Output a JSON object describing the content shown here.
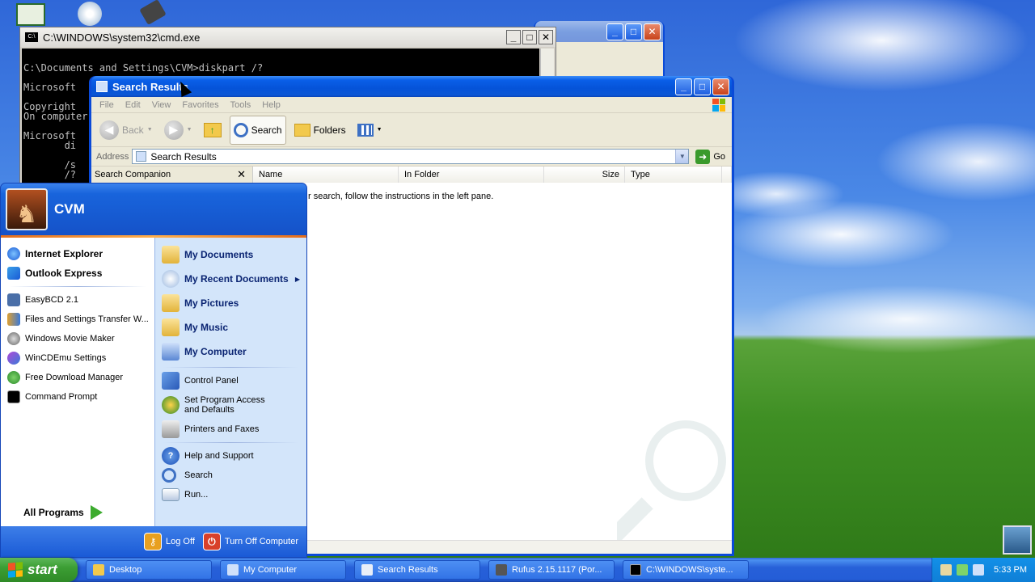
{
  "cmd": {
    "title": "C:\\WINDOWS\\system32\\cmd.exe",
    "lines": [
      "",
      "C:\\Documents and Settings\\CVM>diskpart /?",
      "",
      "Microsoft",
      "",
      "Copyright",
      "On computer",
      "",
      "Microsoft",
      "       di",
      "",
      "       /s",
      "       /?"
    ]
  },
  "search_window": {
    "title": "Search Results",
    "menu": [
      "File",
      "Edit",
      "View",
      "Favorites",
      "Tools",
      "Help"
    ],
    "toolbar": {
      "back": "Back",
      "search": "Search",
      "folders": "Folders"
    },
    "address_label": "Address",
    "address_value": "Search Results",
    "go_label": "Go",
    "companion_title": "Search Companion",
    "columns": [
      "Name",
      "In Folder",
      "Size",
      "Type"
    ],
    "hint": "r search, follow the instructions in the left pane."
  },
  "start_menu": {
    "user": "CVM",
    "pinned": [
      "Internet Explorer",
      "Outlook Express"
    ],
    "recent": [
      "EasyBCD 2.1",
      "Files and Settings Transfer W...",
      "Windows Movie Maker",
      "WinCDEmu Settings",
      "Free Download Manager",
      "Command Prompt"
    ],
    "all_programs": "All Programs",
    "places": [
      "My Documents",
      "My Recent Documents",
      "My Pictures",
      "My Music",
      "My Computer"
    ],
    "settings": [
      "Control Panel",
      "Set Program Access and Defaults",
      "Printers and Faxes"
    ],
    "tools": [
      "Help and Support",
      "Search",
      "Run..."
    ],
    "log_off": "Log Off",
    "turn_off": "Turn Off Computer"
  },
  "taskbar": {
    "start": "start",
    "tasks": [
      "Desktop",
      "My Computer",
      "Search Results",
      "Rufus 2.15.1117 (Por...",
      "C:\\WINDOWS\\syste..."
    ],
    "clock": "5:33 PM"
  }
}
